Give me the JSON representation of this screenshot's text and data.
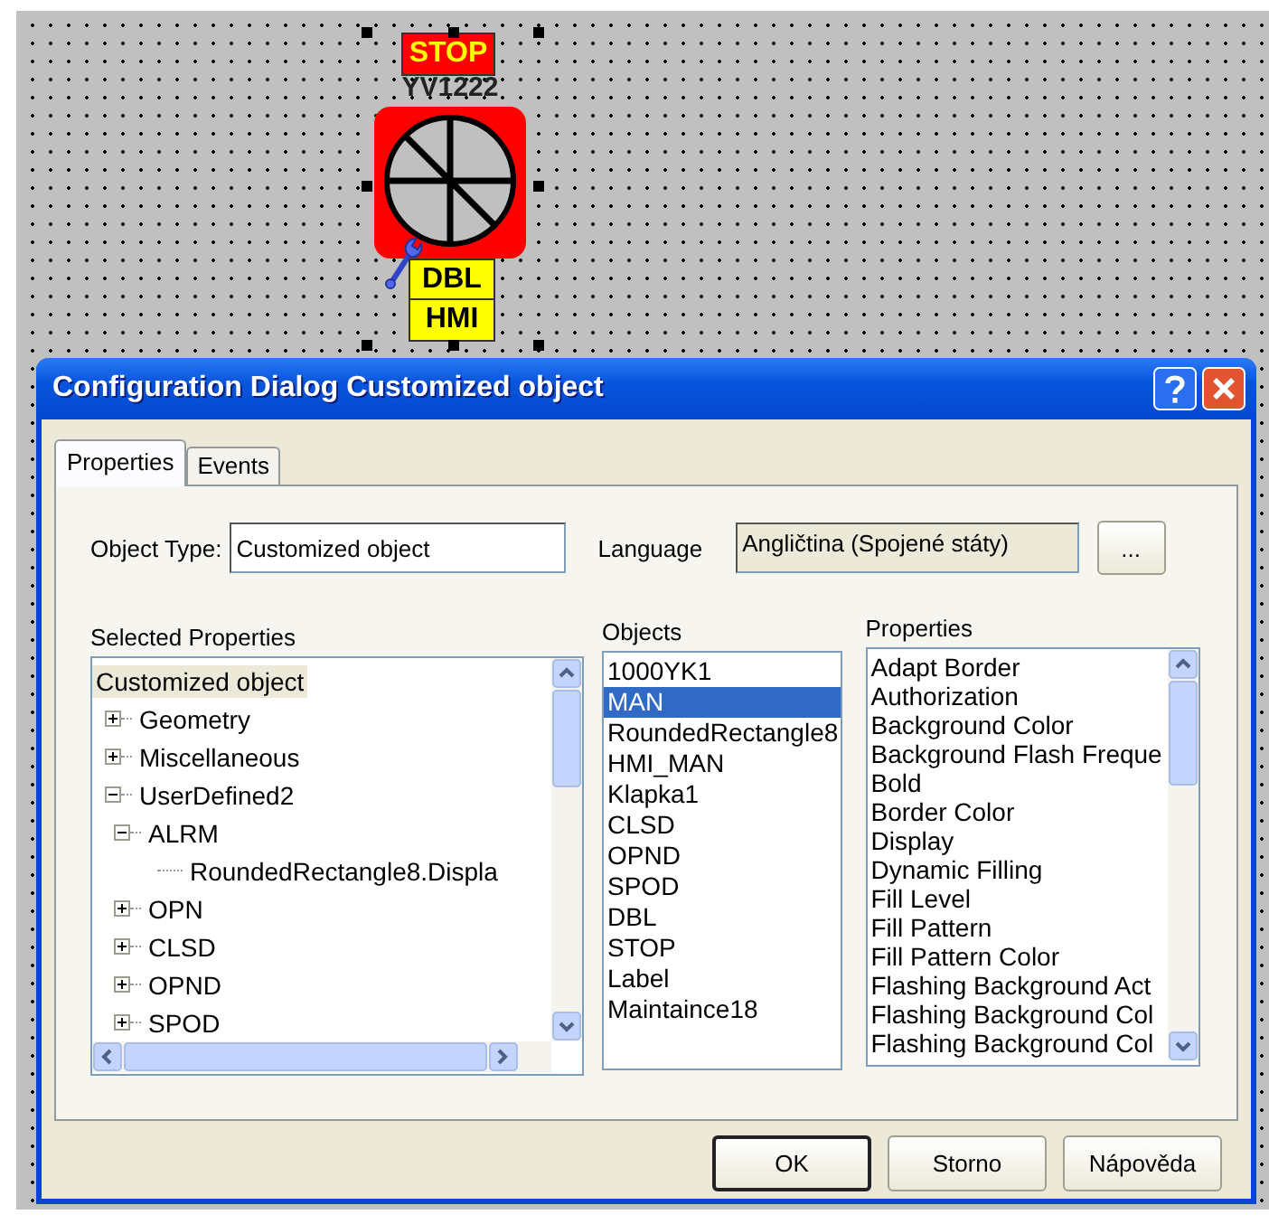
{
  "canvas": {
    "status_badge": "STOP",
    "tag": "YV1222",
    "indicators": [
      "DBL",
      "HMI"
    ]
  },
  "dialog": {
    "title": "Configuration Dialog Customized object",
    "tabs": [
      {
        "label": "Properties",
        "selected": true
      },
      {
        "label": "Events",
        "selected": false
      }
    ],
    "object_type": {
      "label": "Object Type:",
      "value": "Customized object"
    },
    "language": {
      "label": "Language",
      "value": "Angličtina (Spojené státy)",
      "disabled": true,
      "button": "..."
    },
    "selected_properties": {
      "label": "Selected Properties",
      "tree": [
        {
          "label": "Customized object",
          "selected": true,
          "children": [
            {
              "label": "Geometry",
              "selected": false,
              "expanded": false
            },
            {
              "label": "Miscellaneous",
              "selected": false,
              "expanded": false
            },
            {
              "label": "UserDefined2",
              "selected": false,
              "expanded": true,
              "children": [
                {
                  "label": "ALRM",
                  "selected": false,
                  "expanded": true,
                  "children": [
                    {
                      "label": "RoundedRectangle8.Displa",
                      "selected": false
                    }
                  ]
                },
                {
                  "label": "OPN",
                  "selected": false,
                  "expanded": false
                },
                {
                  "label": "CLSD",
                  "selected": false,
                  "expanded": false
                },
                {
                  "label": "OPND",
                  "selected": false,
                  "expanded": false
                },
                {
                  "label": "SPOD",
                  "selected": false,
                  "expanded": false
                }
              ]
            }
          ]
        }
      ]
    },
    "objects": {
      "label": "Objects",
      "items": [
        {
          "label": "1000YK1",
          "selected": false
        },
        {
          "label": "MAN",
          "selected": true
        },
        {
          "label": "RoundedRectangle8",
          "selected": false
        },
        {
          "label": "HMI_MAN",
          "selected": false
        },
        {
          "label": "Klapka1",
          "selected": false
        },
        {
          "label": "CLSD",
          "selected": false
        },
        {
          "label": "OPND",
          "selected": false
        },
        {
          "label": "SPOD",
          "selected": false
        },
        {
          "label": "DBL",
          "selected": false
        },
        {
          "label": "STOP",
          "selected": false
        },
        {
          "label": "Label",
          "selected": false
        },
        {
          "label": "Maintaince18",
          "selected": false
        }
      ]
    },
    "properties": {
      "label": "Properties",
      "items": [
        {
          "label": "Adapt Border",
          "selected": false
        },
        {
          "label": "Authorization",
          "selected": false
        },
        {
          "label": "Background Color",
          "selected": false
        },
        {
          "label": "Background Flash Freque",
          "selected": false
        },
        {
          "label": "Bold",
          "selected": false
        },
        {
          "label": "Border Color",
          "selected": false
        },
        {
          "label": "Display",
          "selected": false
        },
        {
          "label": "Dynamic Filling",
          "selected": false
        },
        {
          "label": "Fill Level",
          "selected": false
        },
        {
          "label": "Fill Pattern",
          "selected": false
        },
        {
          "label": "Fill Pattern Color",
          "selected": false
        },
        {
          "label": "Flashing Background Act",
          "selected": false
        },
        {
          "label": "Flashing Background Col",
          "selected": false
        },
        {
          "label": "Flashing Background Col",
          "selected": false
        }
      ]
    },
    "buttons": [
      {
        "label": "OK",
        "default": true
      },
      {
        "label": "Storno",
        "default": false
      },
      {
        "label": "Nápověda",
        "default": false
      }
    ]
  }
}
